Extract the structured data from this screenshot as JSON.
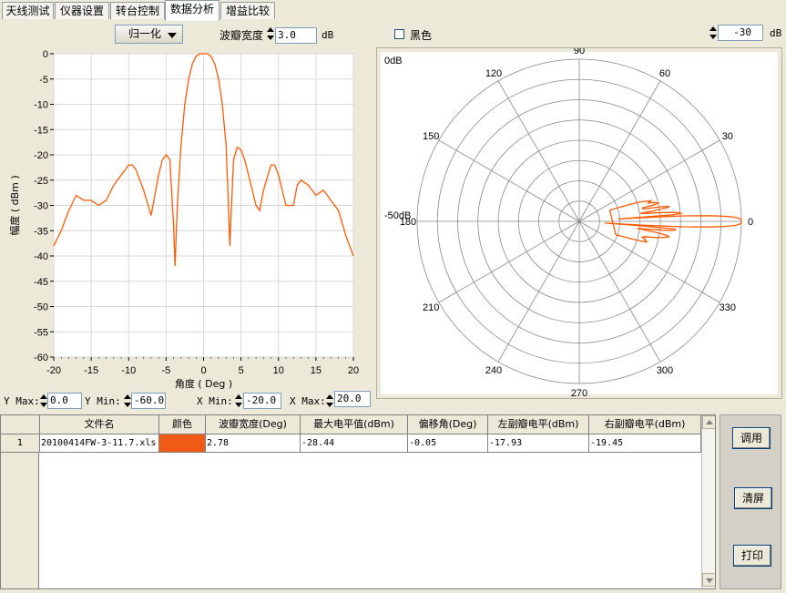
{
  "tabs": [
    {
      "label": "天线测试",
      "active": false
    },
    {
      "label": "仪器设置",
      "active": false
    },
    {
      "label": "转台控制",
      "active": false
    },
    {
      "label": "数据分析",
      "active": true
    },
    {
      "label": "增益比较",
      "active": false
    }
  ],
  "toolbar": {
    "mode_select": "归一化",
    "beamwidth_label": "波瓣宽度",
    "beamwidth_value": "3.0",
    "beamwidth_unit": "dB",
    "black_label": "黑色",
    "black_checked": false,
    "polar_min_value": "-30",
    "polar_min_unit": "dB"
  },
  "rect_chart": {
    "type": "line",
    "ylabel": "幅度 ( dBm )",
    "xlabel": "角度 ( Deg )",
    "xlim": [
      -20,
      20
    ],
    "ylim": [
      -60,
      0
    ],
    "x_ticks": [
      "-20",
      "-15",
      "-10",
      "-5",
      "0",
      "5",
      "10",
      "15",
      "20"
    ],
    "y_ticks": [
      "0",
      "-5",
      "-10",
      "-15",
      "-20",
      "-25",
      "-30",
      "-35",
      "-40",
      "-45",
      "-50",
      "-55",
      "-60"
    ],
    "line_color": "#ff5a00"
  },
  "polar_chart": {
    "type": "line",
    "outer_label": "0dB",
    "inner_label": "-50dB",
    "angle_labels": [
      "0",
      "30",
      "60",
      "90",
      "120",
      "150",
      "180",
      "210",
      "240",
      "270",
      "300",
      "330"
    ],
    "line_color": "#ff5a00"
  },
  "axis_controls": {
    "ymax_label": "Y Max:",
    "ymax_value": "0.0",
    "ymin_label": "Y Min:",
    "ymin_value": "-60.0",
    "xmin_label": "X Min:",
    "xmin_value": "-20.0",
    "xmax_label": "X Max:",
    "xmax_value": "20.0"
  },
  "table": {
    "columns": [
      "文件名",
      "颜色",
      "波瓣宽度(Deg)",
      "最大电平值(dBm)",
      "偏移角(Deg)",
      "左副瓣电平(dBm)",
      "右副瓣电平(dBm)"
    ],
    "rows": [
      {
        "index": "1",
        "file": "20100414FW-3-11.7.xls",
        "color": "#f05a14",
        "beamwidth": "2.78",
        "max_level": "-28.44",
        "offset": "-0.05",
        "left_sidelobe": "-17.93",
        "right_sidelobe": "-19.45"
      }
    ]
  },
  "side_buttons": {
    "load": "调用",
    "clear": "清屏",
    "print": "打印"
  },
  "chart_data": {
    "type": "line",
    "title": "",
    "xlabel": "角度 ( Deg )",
    "ylabel": "幅度 ( dBm )",
    "xlim": [
      -20,
      20
    ],
    "ylim": [
      -60,
      0
    ],
    "x": [
      -20,
      -19,
      -18,
      -17,
      -16,
      -15,
      -14,
      -13,
      -12,
      -11,
      -10,
      -9.5,
      -9,
      -8,
      -7,
      -6,
      -5.5,
      -5,
      -4.5,
      -4,
      -3.8,
      -3.5,
      -3,
      -2.5,
      -2,
      -1.5,
      -1,
      -0.5,
      0,
      0.5,
      1,
      1.5,
      2,
      2.5,
      3,
      3.3,
      3.5,
      4,
      4.5,
      5,
      5.5,
      6,
      7,
      7.5,
      8,
      9,
      9.5,
      10,
      11,
      12,
      12.5,
      13,
      14,
      15,
      16,
      17,
      18,
      19,
      20
    ],
    "series": [
      {
        "values": [
          -38,
          -35,
          -31,
          -28,
          -29,
          -29,
          -30,
          -29,
          -26,
          -24,
          -22,
          -22,
          -23,
          -27,
          -32,
          -24,
          -21,
          -20,
          -21,
          -34,
          -42,
          -30,
          -18,
          -10,
          -5,
          -2,
          -0.5,
          0,
          0,
          0,
          -0.5,
          -2,
          -5,
          -10,
          -18,
          -29,
          -38,
          -21,
          -18.5,
          -19,
          -21,
          -24,
          -30,
          -31,
          -27,
          -22,
          -22,
          -24,
          -30,
          -30,
          -26,
          -25,
          -26,
          -28,
          -27,
          -29,
          -31,
          -36,
          -40
        ]
      }
    ]
  }
}
